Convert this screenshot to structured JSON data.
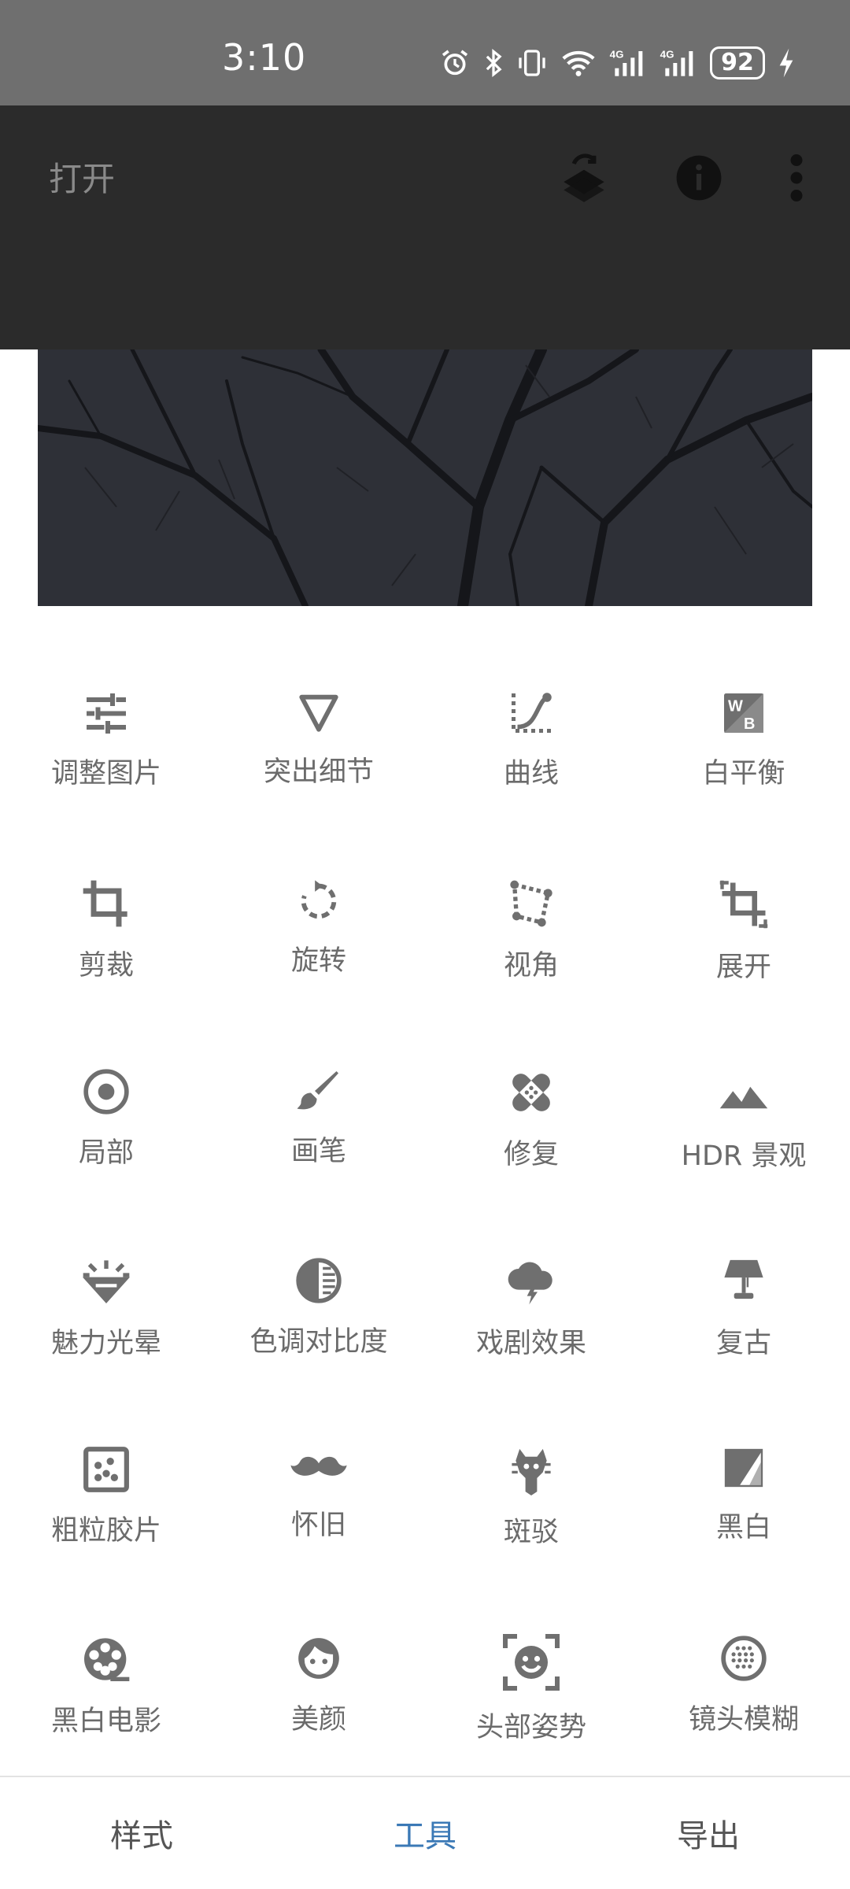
{
  "status_bar": {
    "time": "3:10",
    "battery": "92",
    "icons": [
      "alarm-icon",
      "bluetooth-icon",
      "vibrate-icon",
      "wifi-icon",
      "signal-4g-icon",
      "signal-4g-icon",
      "battery-icon",
      "charging-icon"
    ]
  },
  "app_bar": {
    "open_label": "打开",
    "icons": [
      "layers-icon",
      "info-icon",
      "more-vert-icon"
    ]
  },
  "tools": [
    {
      "label": "调整图片",
      "icon": "tune-sliders-icon"
    },
    {
      "label": "突出细节",
      "icon": "details-triangle-icon"
    },
    {
      "label": "曲线",
      "icon": "curves-icon"
    },
    {
      "label": "白平衡",
      "icon": "white-balance-icon"
    },
    {
      "label": "剪裁",
      "icon": "crop-icon"
    },
    {
      "label": "旋转",
      "icon": "rotate-icon"
    },
    {
      "label": "视角",
      "icon": "perspective-icon"
    },
    {
      "label": "展开",
      "icon": "expand-icon"
    },
    {
      "label": "局部",
      "icon": "selective-icon"
    },
    {
      "label": "画笔",
      "icon": "brush-icon"
    },
    {
      "label": "修复",
      "icon": "healing-bandage-icon"
    },
    {
      "label": "HDR 景观",
      "icon": "hdr-landscape-icon"
    },
    {
      "label": "魅力光晕",
      "icon": "glamour-glow-icon"
    },
    {
      "label": "色调对比度",
      "icon": "tonal-contrast-icon"
    },
    {
      "label": "戏剧效果",
      "icon": "drama-cloud-icon"
    },
    {
      "label": "复古",
      "icon": "vintage-lamp-icon"
    },
    {
      "label": "粗粒胶片",
      "icon": "grainy-film-icon"
    },
    {
      "label": "怀旧",
      "icon": "mustache-icon"
    },
    {
      "label": "斑驳",
      "icon": "grunge-icon"
    },
    {
      "label": "黑白",
      "icon": "black-white-icon"
    },
    {
      "label": "黑白电影",
      "icon": "film-reel-icon"
    },
    {
      "label": "美颜",
      "icon": "face-icon"
    },
    {
      "label": "头部姿势",
      "icon": "head-pose-icon"
    },
    {
      "label": "镜头模糊",
      "icon": "lens-blur-icon"
    }
  ],
  "bottom_nav": {
    "tabs": [
      {
        "label": "样式",
        "active": false
      },
      {
        "label": "工具",
        "active": true
      },
      {
        "label": "导出",
        "active": false
      }
    ]
  },
  "colors": {
    "accent": "#3b79b6",
    "icon_gray": "#6f6f6f",
    "label_gray": "#6b6b6b",
    "status_bar": "#6f6f6f",
    "app_bar": "#2b2b2b"
  }
}
